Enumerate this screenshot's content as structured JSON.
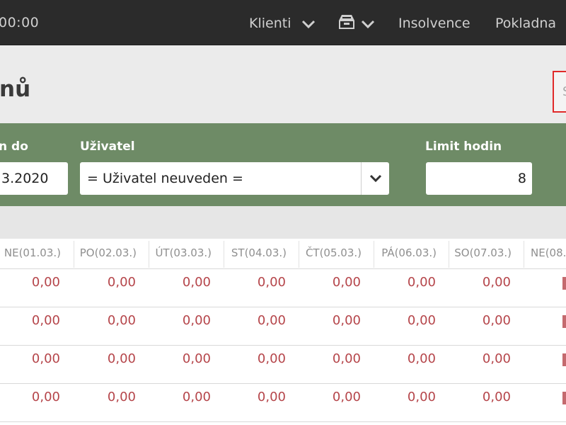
{
  "topbar": {
    "clock": "00:00",
    "nav": [
      {
        "label": "Klienti",
        "has_dropdown": true
      },
      {
        "label": "",
        "icon": "inbox-tray-icon",
        "has_dropdown": true
      },
      {
        "label": "Insolvence",
        "has_dropdown": false
      },
      {
        "label": "Pokladna",
        "has_dropdown": false
      }
    ]
  },
  "page": {
    "title": "nů"
  },
  "search": {
    "placeholder": "S"
  },
  "filters": {
    "date_to_label": "n do",
    "date_to_value": "3.2020",
    "user_label": "Uživatel",
    "user_value": "= Uživatel neuveden =",
    "limit_label": "Limit hodin",
    "limit_value": "8"
  },
  "table": {
    "columns": [
      "NE(01.03.)",
      "PO(02.03.)",
      "ÚT(03.03.)",
      "ST(04.03.)",
      "ČT(05.03.)",
      "PÁ(06.03.)",
      "SO(07.03.)",
      "NE(08."
    ],
    "rows": [
      [
        "0,00",
        "0,00",
        "0,00",
        "0,00",
        "0,00",
        "0,00",
        "0,00"
      ],
      [
        "0,00",
        "0,00",
        "0,00",
        "0,00",
        "0,00",
        "0,00",
        "0,00"
      ],
      [
        "0,00",
        "0,00",
        "0,00",
        "0,00",
        "0,00",
        "0,00",
        "0,00"
      ],
      [
        "0,00",
        "0,00",
        "0,00",
        "0,00",
        "0,00",
        "0,00",
        "0,00"
      ]
    ]
  },
  "colors": {
    "topbar_bg": "#2b2b2b",
    "filter_bg": "#6e8b66",
    "value_red": "#b5454a",
    "search_border": "#e02a2a"
  }
}
